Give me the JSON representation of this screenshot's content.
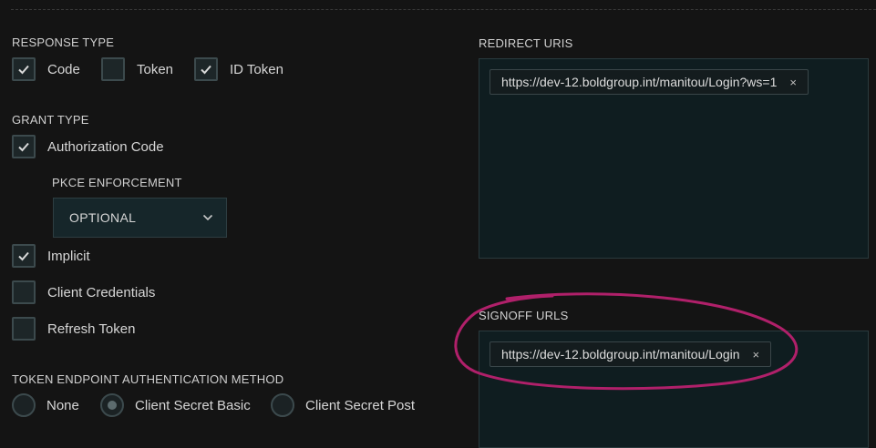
{
  "response_type": {
    "label": "RESPONSE TYPE",
    "options": [
      {
        "label": "Code",
        "checked": true
      },
      {
        "label": "Token",
        "checked": false
      },
      {
        "label": "ID Token",
        "checked": true
      }
    ]
  },
  "grant_type": {
    "label": "GRANT TYPE",
    "authorization_code": {
      "label": "Authorization Code",
      "checked": true
    },
    "pkce": {
      "label": "PKCE ENFORCEMENT",
      "value": "OPTIONAL"
    },
    "implicit": {
      "label": "Implicit",
      "checked": true
    },
    "client_credentials": {
      "label": "Client Credentials",
      "checked": false
    },
    "refresh_token": {
      "label": "Refresh Token",
      "checked": false
    }
  },
  "token_auth": {
    "label": "TOKEN ENDPOINT AUTHENTICATION METHOD",
    "options": [
      {
        "label": "None",
        "selected": false
      },
      {
        "label": "Client Secret Basic",
        "selected": true
      },
      {
        "label": "Client Secret Post",
        "selected": false
      }
    ]
  },
  "redirect_uris": {
    "label": "REDIRECT URIS",
    "items": [
      {
        "value": "https://dev-12.boldgroup.int/manitou/Login?ws=1",
        "remove": "×"
      }
    ]
  },
  "signoff_urls": {
    "label": "SIGNOFF URLS",
    "items": [
      {
        "value": "https://dev-12.boldgroup.int/manitou/Login",
        "remove": "×"
      }
    ]
  },
  "colors": {
    "background": "#141414",
    "control_border": "#3c4a4d",
    "uri_box_bg": "#0f1d20",
    "annotation": "#b0206a"
  },
  "icons": {
    "check": "check-icon",
    "chevron": "chevron-down-icon",
    "close": "close-icon"
  }
}
